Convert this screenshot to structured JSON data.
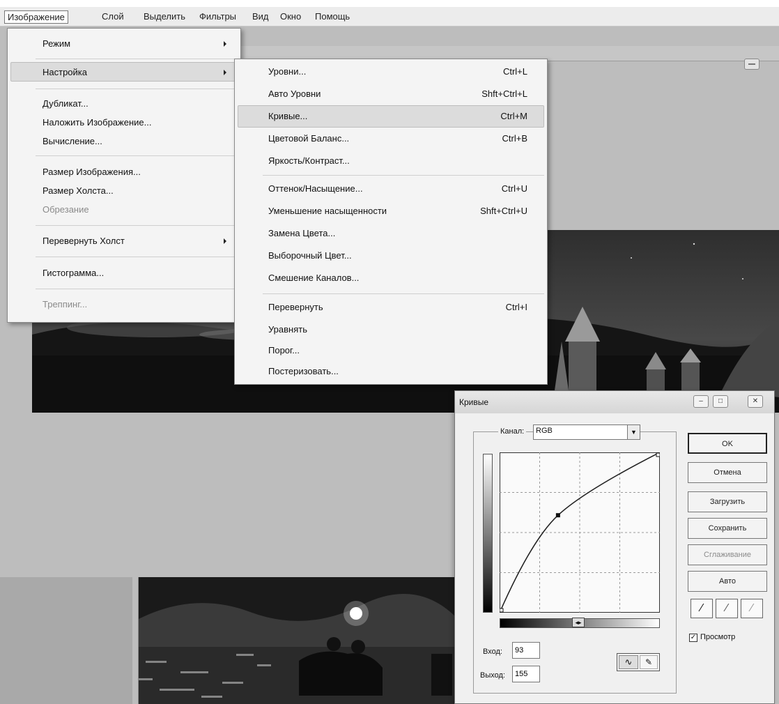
{
  "menubar": {
    "items": [
      "Изображение",
      "Слой",
      "Выделить",
      "Фильтры",
      "Вид",
      "Окно",
      "Помощь"
    ]
  },
  "image_menu": {
    "items": [
      {
        "label": "Режим",
        "submenu": true
      },
      {
        "label": "Настройка",
        "submenu": true,
        "highlighted": true
      },
      {
        "label": "Дубликат..."
      },
      {
        "label": "Наложить Изображение..."
      },
      {
        "label": "Вычисление..."
      },
      {
        "label": "Размер Изображения..."
      },
      {
        "label": "Размер Холста..."
      },
      {
        "label": "Обрезание",
        "disabled": true
      },
      {
        "label": "Перевернуть Холст",
        "submenu": true
      },
      {
        "label": "Гистограмма..."
      },
      {
        "label": "Треппинг...",
        "disabled": true
      }
    ]
  },
  "adjust_menu": {
    "items": [
      {
        "label": "Уровни...",
        "shortcut": "Ctrl+L"
      },
      {
        "label": "Авто Уровни",
        "shortcut": "Shft+Ctrl+L"
      },
      {
        "label": "Кривые...",
        "shortcut": "Ctrl+M",
        "highlighted": true
      },
      {
        "label": "Цветовой Баланс...",
        "shortcut": "Ctrl+B"
      },
      {
        "label": "Яркость/Контраст...",
        "shortcut": ""
      },
      {
        "label": "Оттенок/Насыщение...",
        "shortcut": "Ctrl+U"
      },
      {
        "label": "Уменьшение насыщенности",
        "shortcut": "Shft+Ctrl+U"
      },
      {
        "label": "Замена Цвета...",
        "shortcut": ""
      },
      {
        "label": "Выборочный Цвет...",
        "shortcut": ""
      },
      {
        "label": "Смешение Каналов...",
        "shortcut": ""
      },
      {
        "label": "Перевернуть",
        "shortcut": "Ctrl+I"
      },
      {
        "label": "Уравнять",
        "shortcut": ""
      },
      {
        "label": "Порог...",
        "shortcut": ""
      },
      {
        "label": "Постеризовать...",
        "shortcut": ""
      }
    ]
  },
  "curves": {
    "title": "Кривые",
    "channel_label": "Канал:",
    "channel_value": "RGB",
    "input_label": "Вход:",
    "input_value": "93",
    "output_label": "Выход:",
    "output_value": "155",
    "preview_label": "Просмотр",
    "preview_checked": true,
    "buttons": {
      "ok": "OK",
      "cancel": "Отмена",
      "load": "Загрузить",
      "save": "Сохранить",
      "smooth": "Сглаживание",
      "auto": "Авто"
    },
    "curve_point": {
      "input": 93,
      "output": 155
    }
  },
  "colors": {
    "menu_bg": "#f4f4f4",
    "highlight": "#dcdcdc",
    "workspace": "#bdbdbd"
  }
}
